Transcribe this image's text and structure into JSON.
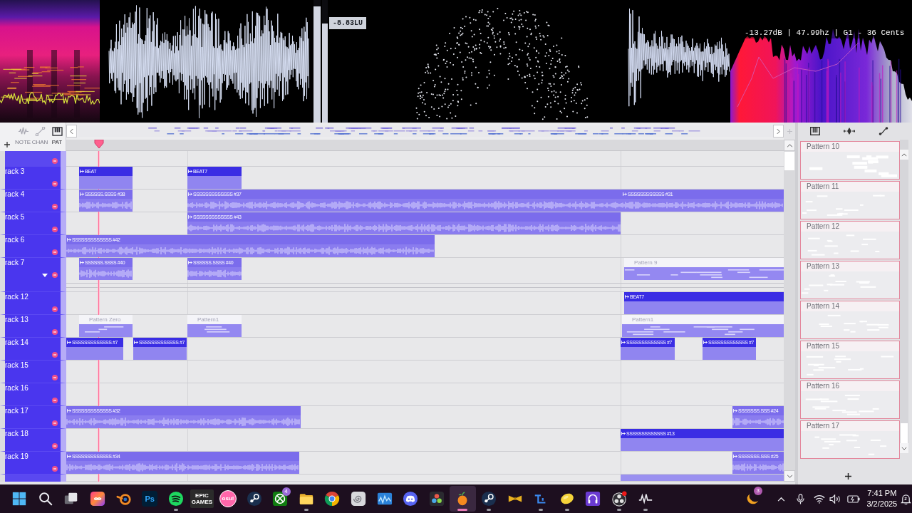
{
  "visualizers": {
    "meters": [
      {
        "level": 0.95
      },
      {
        "level": 0.81
      }
    ],
    "loudness_reading": "-8.83LU",
    "pitch_reading": "-13.27dB | 47.99hz | G1 - 36 Cents"
  },
  "playlist": {
    "tools": [
      {
        "label": "NOTE",
        "selected": false
      },
      {
        "label": "CHAN",
        "selected": false
      },
      {
        "label": "PAT",
        "selected": true
      }
    ],
    "tracks": [
      {
        "name": "rack 3",
        "expanded": false,
        "clips": [
          {
            "kind": "pattern",
            "label": "BEAT"
          },
          {
            "kind": "pattern",
            "label": "BEAT7"
          }
        ]
      },
      {
        "name": "rack 4",
        "expanded": false,
        "clips": [
          {
            "kind": "audio",
            "label": "SSSSSS.SSSS #38"
          },
          {
            "kind": "audio",
            "label": "SSSSSSSSSSSSS #37"
          },
          {
            "kind": "audio",
            "label": "SSSSSSSSSSSS #31"
          }
        ]
      },
      {
        "name": "rack 5",
        "expanded": false,
        "clips": [
          {
            "kind": "audio",
            "label": "SSSSSSSSSSSSS #43"
          }
        ]
      },
      {
        "name": "rack 6",
        "expanded": false,
        "clips": [
          {
            "kind": "audio",
            "label": "SSSSSSSSSSSSS #42"
          }
        ]
      },
      {
        "name": "rack 7",
        "expanded": true,
        "clips": [
          {
            "kind": "audio",
            "label": "SSSSSS.SSSS #40"
          },
          {
            "kind": "audio",
            "label": "SSSSSS.SSSS #40"
          },
          {
            "kind": "notes",
            "label": "Pattern 9"
          }
        ]
      },
      {
        "name": "rack 12",
        "expanded": false,
        "clips": [
          {
            "kind": "pattern",
            "label": "BEAT7"
          }
        ]
      },
      {
        "name": "rack 13",
        "expanded": false,
        "clips": [
          {
            "kind": "notes",
            "label": "Pattern Zero"
          },
          {
            "kind": "notes",
            "label": "Pattern1"
          },
          {
            "kind": "notes",
            "label": "Pattern1"
          }
        ]
      },
      {
        "name": "rack 14",
        "expanded": false,
        "clips": [
          {
            "kind": "pattern",
            "label": "SSSSSSSSSSSSS #7"
          },
          {
            "kind": "pattern",
            "label": "SSSSSSSSSSSSS #7"
          },
          {
            "kind": "pattern",
            "label": "SSSSSSSSSSSSS #7"
          },
          {
            "kind": "pattern",
            "label": "SSSSSSSSSSSSS #7"
          }
        ]
      },
      {
        "name": "rack 15",
        "expanded": false
      },
      {
        "name": "rack 16",
        "expanded": false
      },
      {
        "name": "rack 17",
        "expanded": false,
        "clips": [
          {
            "kind": "audio",
            "label": "SSSSSSSSSSSSS #32"
          },
          {
            "kind": "audio",
            "label": "SSSSSSS.SSS #24"
          }
        ]
      },
      {
        "name": "rack 18",
        "expanded": false,
        "clips": [
          {
            "kind": "pattern",
            "label": "SSSSSSSSSSSSS #13"
          }
        ]
      },
      {
        "name": "rack 19",
        "expanded": false,
        "clips": [
          {
            "kind": "audio",
            "label": "SSSSSSSSSSSSS #34"
          },
          {
            "kind": "audio",
            "label": "SSSSSSS.SSS #25"
          }
        ]
      }
    ]
  },
  "patterns": [
    {
      "label": "Pattern 10"
    },
    {
      "label": "Pattern 11"
    },
    {
      "label": "Pattern 12"
    },
    {
      "label": "Pattern 13"
    },
    {
      "label": "Pattern 14"
    },
    {
      "label": "Pattern 15"
    },
    {
      "label": "Pattern 16"
    },
    {
      "label": "Pattern 17"
    }
  ],
  "taskbar": {
    "buttons": [
      {
        "running": false,
        "selected": false
      },
      {
        "running": false,
        "selected": false
      },
      {
        "running": false,
        "selected": false
      },
      {
        "running": false,
        "selected": false
      },
      {
        "running": false,
        "selected": false
      },
      {
        "label": "Ps",
        "running": false,
        "selected": false
      },
      {
        "running": true,
        "selected": false
      },
      {
        "label": "EPIC GAMES",
        "running": false,
        "selected": false
      },
      {
        "label": "osu!",
        "running": false,
        "selected": false
      },
      {
        "running": false,
        "selected": false
      },
      {
        "badge": "4",
        "running": false,
        "selected": false
      },
      {
        "running": true,
        "selected": false
      },
      {
        "running": false,
        "selected": false
      },
      {
        "running": false,
        "selected": false
      },
      {
        "running": false,
        "selected": false
      },
      {
        "running": false,
        "selected": false
      },
      {
        "running": false,
        "selected": false
      },
      {
        "running": true,
        "selected": true
      },
      {
        "running": true,
        "selected": false
      },
      {
        "running": false,
        "selected": false
      },
      {
        "running": true,
        "selected": false
      },
      {
        "running": true,
        "selected": false
      },
      {
        "running": false,
        "selected": false
      },
      {
        "running": true,
        "selected": false
      },
      {
        "running": true,
        "selected": false
      }
    ],
    "tray": {
      "badge": "3",
      "time": "7:41 PM",
      "date": "3/2/2025"
    }
  }
}
